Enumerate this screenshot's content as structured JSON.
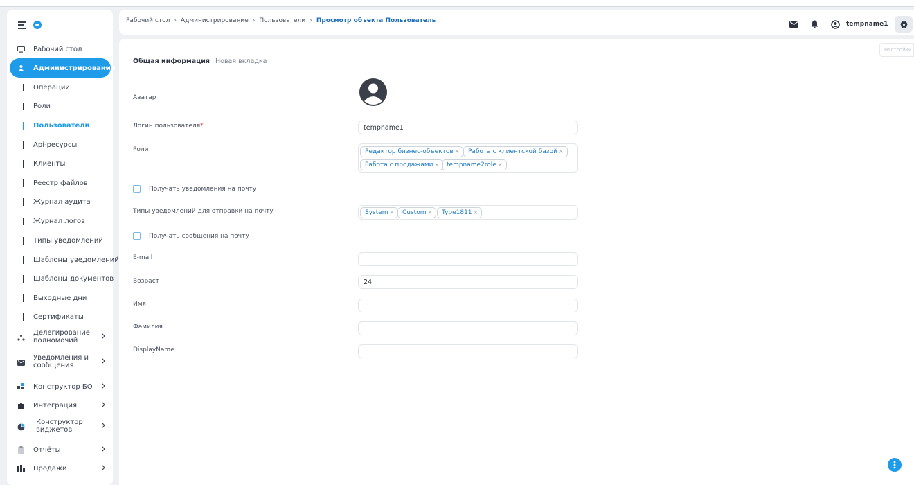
{
  "sidebar": {
    "items": [
      {
        "label": "Рабочий стол",
        "icon": "monitor-icon"
      },
      {
        "label": "Администрирование",
        "icon": "admin-icon",
        "active": true
      },
      {
        "label": "Делегирование полномочий",
        "icon": "delegation-icon"
      },
      {
        "label": "Уведомления и сообщения",
        "icon": "mail-icon"
      },
      {
        "label": "Конструктор БО",
        "icon": "constructor-icon"
      },
      {
        "label": "Интеграция",
        "icon": "puzzle-icon"
      },
      {
        "label": "Конструктор виджетов",
        "icon": "widget-icon"
      },
      {
        "label": "Отчёты",
        "icon": "clipboard-icon"
      },
      {
        "label": "Продажи",
        "icon": "sales-icon"
      }
    ],
    "sub_items": [
      "Операции",
      "Роли",
      "Пользователи",
      "Api-ресурсы",
      "Клиенты",
      "Реестр файлов",
      "Журнал аудита",
      "Журнал логов",
      "Типы уведомлений",
      "Шаблоны уведомлений",
      "Шаблоны документов",
      "Выходные дни",
      "Сертификаты"
    ],
    "delegation_line1": "Делегирование",
    "delegation_line2": "полномочий",
    "notif_line1": "Уведомления и",
    "notif_line2": "сообщения",
    "widget_line1": "Конструктор",
    "widget_line2": "виджетов"
  },
  "header": {
    "breadcrumbs": [
      "Рабочий стол",
      "Администрирование",
      "Пользователи",
      "Просмотр объекта Пользователь"
    ],
    "separator": "›",
    "username": "tempname1"
  },
  "main": {
    "settings_label": "Настройки",
    "tabs": [
      "Общая информация",
      "Новая вкладка"
    ],
    "fields": {
      "avatar_label": "Аватар",
      "login_label": "Логин пользователя",
      "login_required": "*",
      "login_value": "tempname1",
      "roles_label": "Роли",
      "roles": [
        "Редактор бизнес-объектов",
        "Работа с клиентской базой",
        "Работа с продажами",
        "tempname2role"
      ],
      "receive_notifications_label": "Получать уведомления на почту",
      "notif_types_label": "Типы уведомлений для отправки на почту",
      "notif_types": [
        "System",
        "Custom",
        "Type1811"
      ],
      "receive_messages_label": "Получать сообщения на почту",
      "email_label": "E-mail",
      "email_value": "",
      "age_label": "Возраст",
      "age_value": "24",
      "first_name_label": "Имя",
      "first_name_value": "",
      "last_name_label": "Фамилия",
      "last_name_value": "",
      "display_name_label": "DisplayName",
      "display_name_value": ""
    },
    "chip_remove_glyph": "×"
  },
  "colors": {
    "accent": "#1e9be9",
    "background": "#eef0f3"
  }
}
